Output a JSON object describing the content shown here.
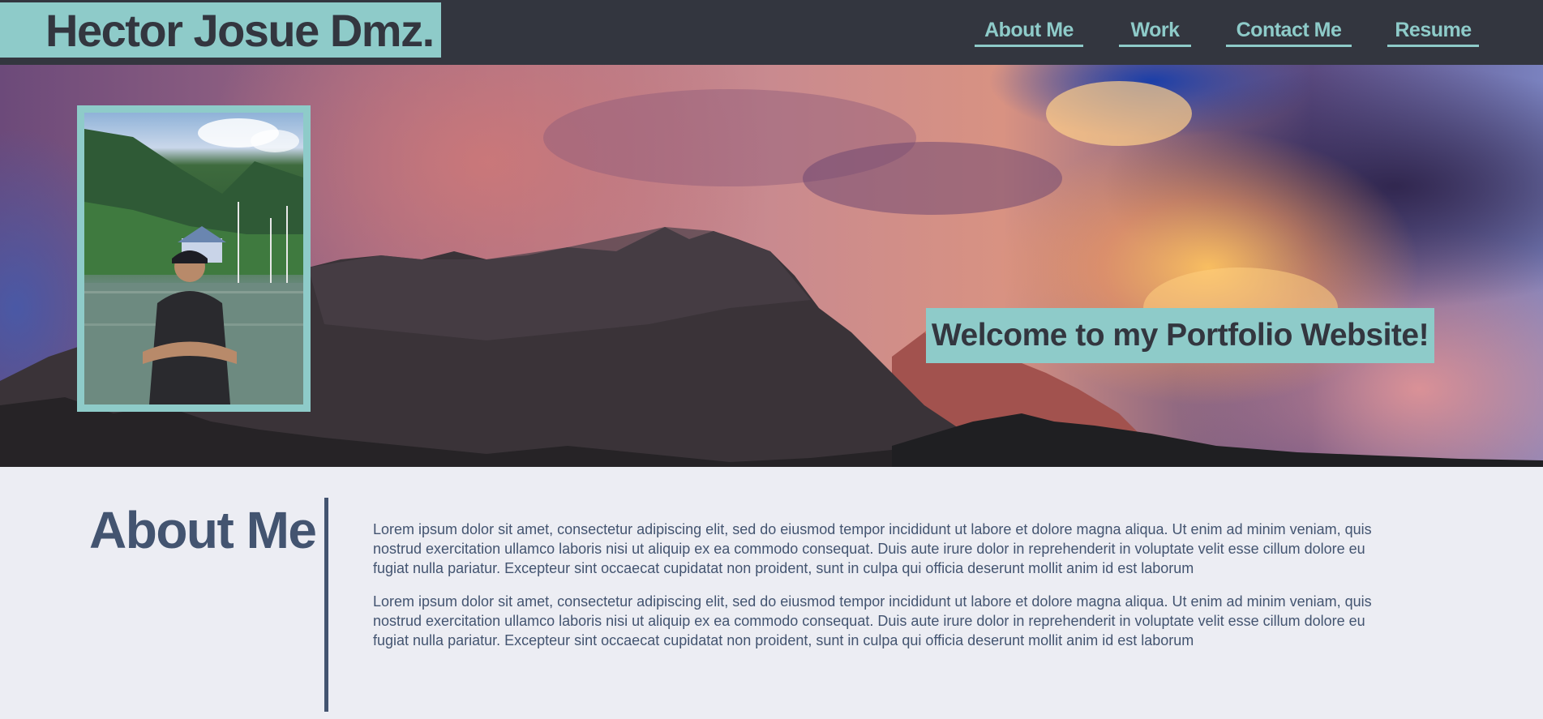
{
  "header": {
    "brand": "Hector Josue Dmz.",
    "nav": [
      {
        "label": "About Me"
      },
      {
        "label": "Work"
      },
      {
        "label": "Contact Me"
      },
      {
        "label": "Resume"
      }
    ]
  },
  "hero": {
    "welcome": "Welcome to my Portfolio Website!"
  },
  "about": {
    "title": "About Me",
    "paragraphs": [
      "Lorem ipsum dolor sit amet, consectetur adipiscing elit, sed do eiusmod tempor incididunt ut labore et dolore magna aliqua. Ut enim ad minim veniam, quis nostrud exercitation ullamco laboris nisi ut aliquip ex ea commodo consequat. Duis aute irure dolor in reprehenderit in voluptate velit esse cillum dolore eu fugiat nulla pariatur. Excepteur sint occaecat cupidatat non proident, sunt in culpa qui officia deserunt mollit anim id est laborum",
      "Lorem ipsum dolor sit amet, consectetur adipiscing elit, sed do eiusmod tempor incididunt ut labore et dolore magna aliqua. Ut enim ad minim veniam, quis nostrud exercitation ullamco laboris nisi ut aliquip ex ea commodo consequat. Duis aute irure dolor in reprehenderit in voluptate velit esse cillum dolore eu fugiat nulla pariatur. Excepteur sint occaecat cupidatat non proident, sunt in culpa qui officia deserunt mollit anim id est laborum"
    ]
  },
  "colors": {
    "header_bg": "#33363f",
    "accent": "#8ecbc9",
    "text_dark": "#435470",
    "page_bg": "#ecedf3"
  }
}
